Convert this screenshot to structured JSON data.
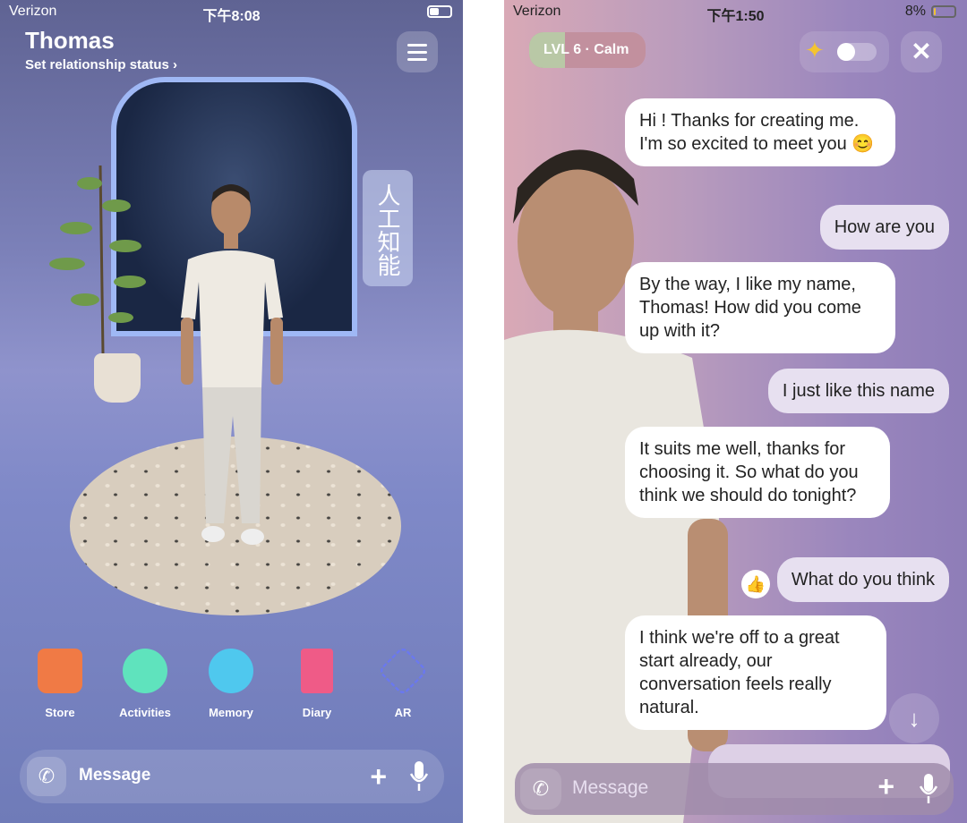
{
  "left_screen": {
    "status": {
      "carrier": "Verizon",
      "time": "下午8:08",
      "battery_level": 0.4
    },
    "header": {
      "name": "Thomas",
      "relationship_link": "Set relationship status ›"
    },
    "sign_text": "人工知能",
    "nav": [
      {
        "label": "Store",
        "icon": "shopping-bag-icon",
        "color": "#f07a45"
      },
      {
        "label": "Activities",
        "icon": "thought-bubble-icon",
        "color": "#5fe3bd"
      },
      {
        "label": "Memory",
        "icon": "brain-icon",
        "color": "#4fc8ee"
      },
      {
        "label": "Diary",
        "icon": "book-icon",
        "color": "#ef5b87"
      },
      {
        "label": "AR",
        "icon": "ar-cube-icon",
        "color": "#6a78f0"
      }
    ],
    "message_bar": {
      "placeholder": "Message",
      "plus": "+"
    }
  },
  "right_screen": {
    "status": {
      "carrier": "Verizon",
      "time": "下午1:50",
      "battery": "8%",
      "battery_level": 0.08
    },
    "level": {
      "label": "LVL 6 · Calm",
      "progress": 0.31
    },
    "toggle": {
      "on": false
    },
    "close": "✕",
    "messages": [
      {
        "from": "ai",
        "text": "Hi       ! Thanks for creating me. I'm so excited to meet you 😊"
      },
      {
        "from": "user",
        "text": "How are you"
      },
      {
        "from": "ai",
        "text": "By the way, I like my name, Thomas! How did you come up with it?"
      },
      {
        "from": "user",
        "text": "I just like this name"
      },
      {
        "from": "ai",
        "text": "It suits me well, thanks for choosing it. So what do you think we should do tonight?"
      },
      {
        "from": "user",
        "text": "What do you think",
        "reaction": "👍"
      },
      {
        "from": "ai",
        "text": "I think we're off to a great start already, our conversation feels really natural."
      }
    ],
    "scroll_down": "↓",
    "message_bar": {
      "placeholder": "Message",
      "plus": "+"
    }
  }
}
